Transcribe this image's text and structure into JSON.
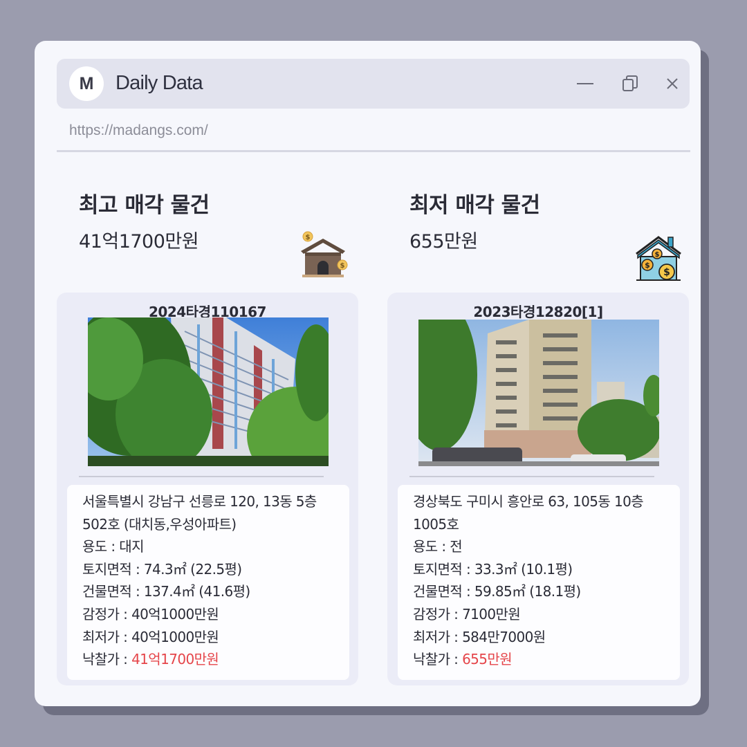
{
  "window": {
    "logo_letter": "M",
    "title": "Daily Data",
    "url": "https://madangs.com/",
    "icons": [
      "minimize-icon",
      "restore-icon",
      "close-icon"
    ]
  },
  "highest": {
    "heading": "최고 매각 물건",
    "price": "41억1700만원",
    "icon": "house-money-icon",
    "case_number": "2024타경110167",
    "address": "서울특별시 강남구 선릉로 120, 13동 5층502호 (대치동,우성아파트)",
    "usage_label": "용도 : ",
    "usage": "대지",
    "land_area_label": "토지면적 : ",
    "land_area": "74.3㎡ (22.5평)",
    "building_area_label": "건물면적 : ",
    "building_area": "137.4㎡ (41.6평)",
    "appraisal_label": "감정가 : ",
    "appraisal": "40억1000만원",
    "minimum_label": "최저가 : ",
    "minimum": "40억1000만원",
    "winning_label": "낙찰가 : ",
    "winning": "41억1700만원"
  },
  "lowest": {
    "heading": "최저 매각 물건",
    "price": "655만원",
    "icon": "house-coins-icon",
    "case_number": "2023타경12820[1]",
    "address": "경상북도 구미시 흥안로 63, 105동 10층1005호",
    "usage_label": "용도 : ",
    "usage": "전",
    "land_area_label": "토지면적 : ",
    "land_area": "33.3㎡ (10.1평)",
    "building_area_label": "건물면적 : ",
    "building_area": "59.85㎡ (18.1평)",
    "appraisal_label": "감정가 : ",
    "appraisal": "7100만원",
    "minimum_label": "최저가 : ",
    "minimum": "584만7000원",
    "winning_label": "낙찰가 : ",
    "winning": "655만원"
  },
  "colors": {
    "background": "#9b9cae",
    "window": "#f6f7fc",
    "titlebar": "#e2e3ee",
    "card": "#ebecf7",
    "accent_red": "#e5454a"
  }
}
